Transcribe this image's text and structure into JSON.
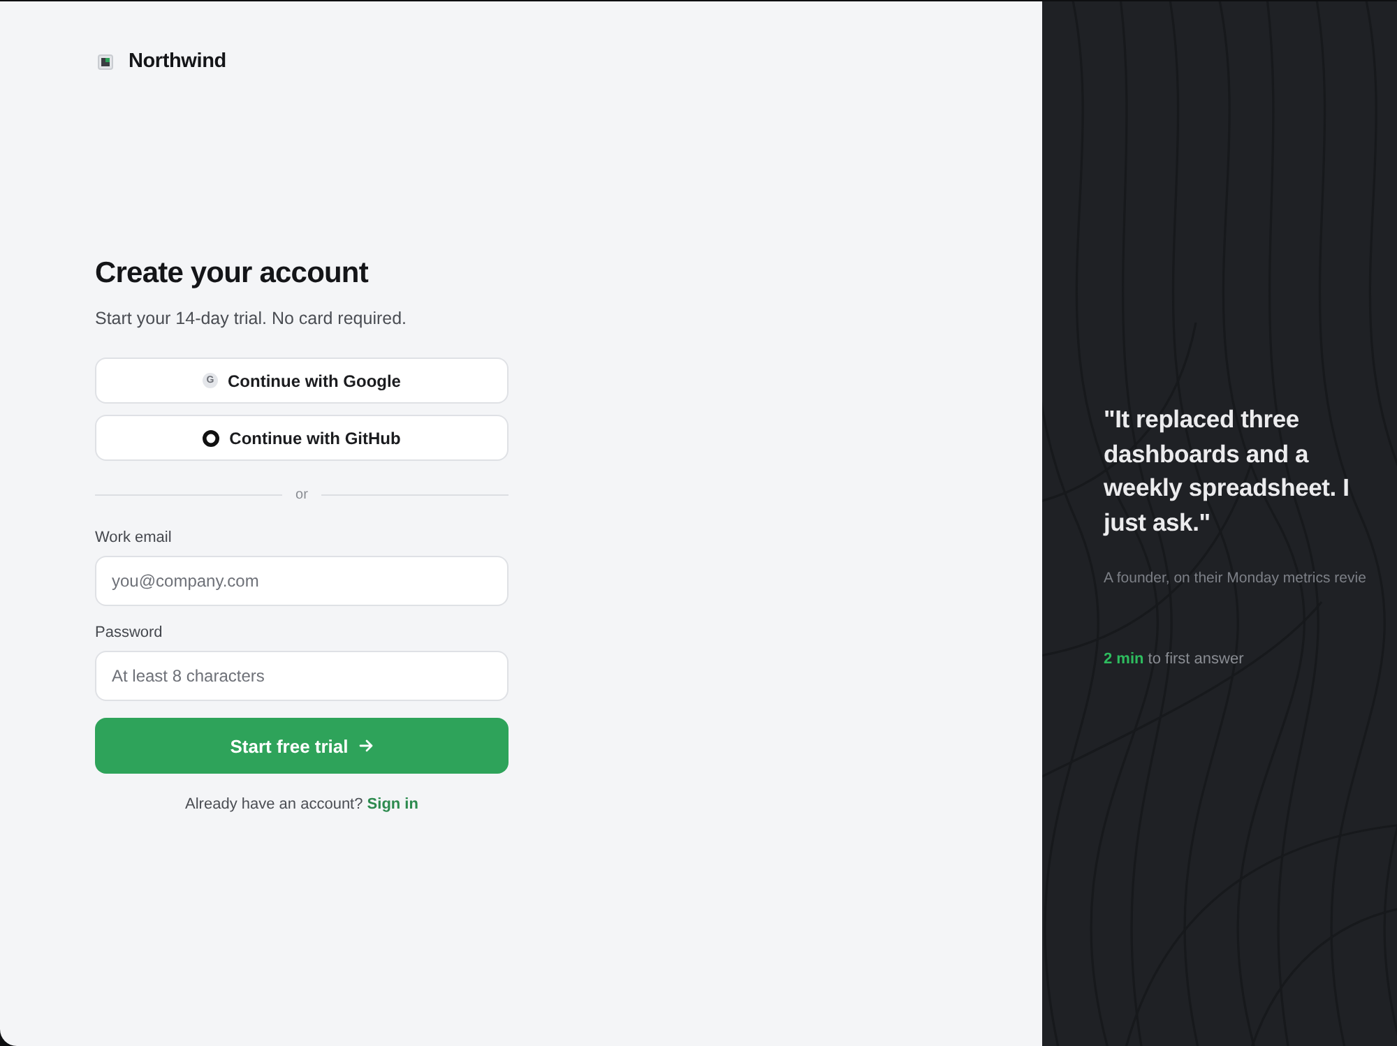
{
  "brand": {
    "name": "Northwind"
  },
  "form": {
    "title": "Create your account",
    "subtitle": "Start your 14-day trial. No card required.",
    "providers": [
      {
        "kind": "google",
        "icon_text": "G",
        "label": "Continue with Google"
      },
      {
        "kind": "github",
        "label": "Continue with GitHub"
      }
    ],
    "divider": "or",
    "fields": [
      {
        "label": "Work email",
        "placeholder": "you@company.com"
      },
      {
        "label": "Password",
        "placeholder": "At least 8 characters"
      }
    ],
    "submit": {
      "label": "Start free trial"
    },
    "signin_prompt": {
      "text": "Already have an account?",
      "link": "Sign in"
    }
  },
  "testimonial": {
    "quote": "\"It replaced three dashboards and a weekly spreadsheet. I just ask.\"",
    "attribution": "A founder, on their Monday metrics revie",
    "stat": "**2 min** to first answer"
  }
}
